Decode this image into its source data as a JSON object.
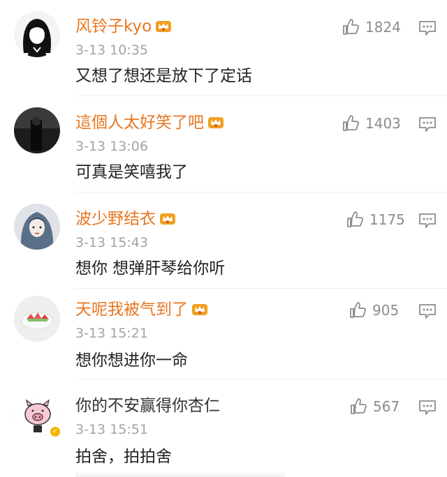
{
  "comments": [
    {
      "username": "风铃子kyo",
      "time": "3-13 10:35",
      "text": "又想了想还是放下了定话",
      "likes": "1824",
      "vip": true
    },
    {
      "username": "這個人太好笑了吧",
      "time": "3-13 13:06",
      "text": "可真是笑嘻我了",
      "likes": "1403",
      "vip": true
    },
    {
      "username": "波少野结衣",
      "time": "3-13 15:43",
      "text": "想你 想弹肝琴给你听",
      "likes": "1175",
      "vip": true
    },
    {
      "username": "天呢我被气到了",
      "time": "3-13 15:21",
      "text": "想你想进你一命",
      "likes": "905",
      "vip": true
    },
    {
      "username": "你的不安赢得你杏仁",
      "time": "3-13 15:51",
      "text": "拍舍，拍拍舍",
      "likes": "567",
      "vip": false,
      "verified": true
    }
  ],
  "icons": {
    "like": "thumbs-up-icon",
    "reply": "comment-icon",
    "vip": "vip-crown-icon",
    "verified": "verified-badge-icon"
  },
  "colors": {
    "vip_username": "#e8761f",
    "normal_username": "#333333",
    "meta": "#a3a3a3",
    "icon": "#8c8c8c"
  }
}
